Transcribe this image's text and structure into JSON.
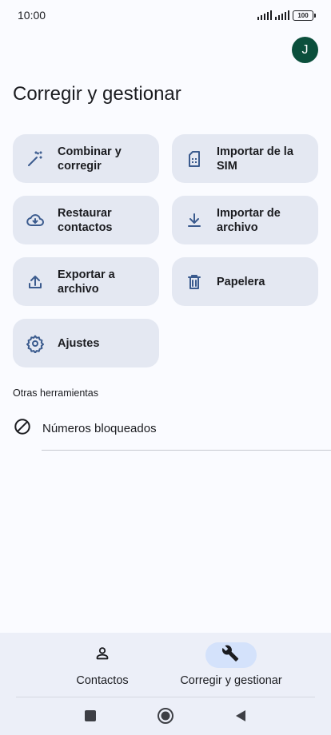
{
  "status": {
    "time": "10:00",
    "battery": "100"
  },
  "header": {
    "avatar_letter": "J",
    "title": "Corregir y gestionar"
  },
  "tools": [
    {
      "label": "Combinar y corregir",
      "icon": "magic-wand-icon"
    },
    {
      "label": "Importar de la SIM",
      "icon": "sim-card-icon"
    },
    {
      "label": "Restaurar contactos",
      "icon": "cloud-download-icon"
    },
    {
      "label": "Importar de archivo",
      "icon": "download-icon"
    },
    {
      "label": "Exportar a archivo",
      "icon": "upload-icon"
    },
    {
      "label": "Papelera",
      "icon": "trash-icon"
    },
    {
      "label": "Ajustes",
      "icon": "gear-icon"
    }
  ],
  "other_tools": {
    "title": "Otras herramientas",
    "items": [
      {
        "label": "Números bloqueados",
        "icon": "block-icon"
      }
    ]
  },
  "bottom_nav": {
    "items": [
      {
        "label": "Contactos",
        "icon": "person-icon",
        "active": false
      },
      {
        "label": "Corregir y gestionar",
        "icon": "wrench-icon",
        "active": true
      }
    ]
  },
  "colors": {
    "accent": "#3b5b8e",
    "card": "#e4e8f2",
    "avatar": "#0b4f3c",
    "active_pill": "#d4e2fb"
  }
}
